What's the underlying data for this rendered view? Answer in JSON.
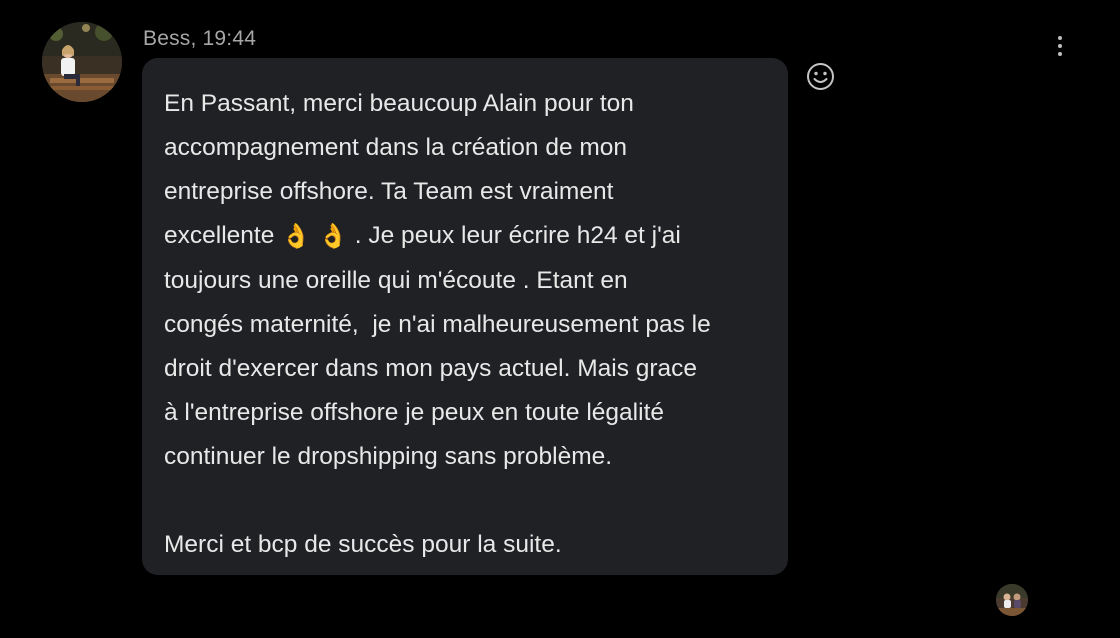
{
  "message": {
    "sender": "Bess",
    "time": "19:44",
    "lines": [
      "En Passant, merci beaucoup Alain pour ton",
      "accompagnement dans la création de mon",
      "entreprise offshore. Ta Team est vraiment",
      "excellente",
      ". Je peux leur écrire h24 et j'ai",
      "toujours une oreille qui m'écoute . Etant en",
      "congés maternité,  je n'ai malheureusement pas le",
      "droit d'exercer dans mon pays actuel. Mais grace",
      "à l'entreprise offshore je peux en toute légalité",
      "continuer le dropshipping sans problème.",
      "Merci et bcp de succès pour la suite."
    ],
    "emoji": "👌"
  },
  "icons": {
    "sender_avatar": "avatar",
    "reaction": "smiley-icon",
    "more": "more-vertical-icon",
    "read_receipt": "read-receipt-avatar"
  },
  "colors": {
    "background": "#000000",
    "bubble": "#1f2124",
    "text": "#e8e8e8",
    "meta_text": "#a6a6a6"
  }
}
